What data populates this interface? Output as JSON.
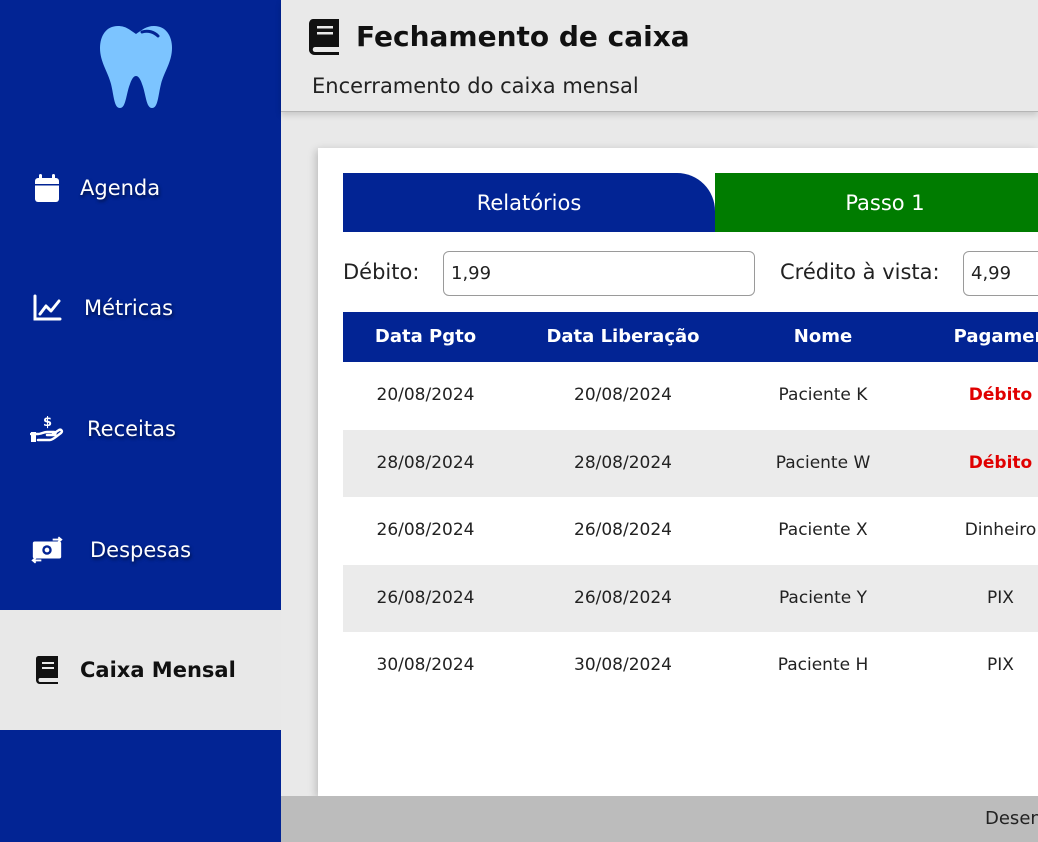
{
  "sidebar": {
    "logo_icon": "tooth-icon",
    "items": [
      {
        "label": "Agenda",
        "icon": "calendar-icon"
      },
      {
        "label": "Métricas",
        "icon": "chart-line-icon"
      },
      {
        "label": "Receitas",
        "icon": "hand-dollar-icon"
      },
      {
        "label": "Despesas",
        "icon": "money-exchange-icon"
      },
      {
        "label": "Caixa Mensal",
        "icon": "book-icon",
        "active": true
      }
    ]
  },
  "header": {
    "icon": "book-icon",
    "title": "Fechamento de caixa",
    "subtitle": "Encerramento do caixa mensal"
  },
  "tabs": {
    "relatorios": "Relatórios",
    "passo1": "Passo 1"
  },
  "fields": {
    "debito_label": "Débito:",
    "debito_value": "1,99",
    "credito_label": "Crédito à vista:",
    "credito_value": "4,99"
  },
  "table": {
    "headers": [
      "Data Pgto",
      "Data Liberação",
      "Nome",
      "Pagamen"
    ],
    "rows": [
      {
        "data_pgto": "20/08/2024",
        "data_liberacao": "20/08/2024",
        "nome": "Paciente K",
        "pagamento": "Débito"
      },
      {
        "data_pgto": "28/08/2024",
        "data_liberacao": "28/08/2024",
        "nome": "Paciente W",
        "pagamento": "Débito"
      },
      {
        "data_pgto": "26/08/2024",
        "data_liberacao": "26/08/2024",
        "nome": "Paciente X",
        "pagamento": "Dinheiro"
      },
      {
        "data_pgto": "26/08/2024",
        "data_liberacao": "26/08/2024",
        "nome": "Paciente Y",
        "pagamento": "PIX"
      },
      {
        "data_pgto": "30/08/2024",
        "data_liberacao": "30/08/2024",
        "nome": "Paciente H",
        "pagamento": "PIX"
      }
    ]
  },
  "footer": {
    "text": "Desen"
  },
  "colors": {
    "primary": "#022494",
    "success": "#007c00",
    "debit": "#e00000",
    "logo": "#7cc4ff"
  }
}
